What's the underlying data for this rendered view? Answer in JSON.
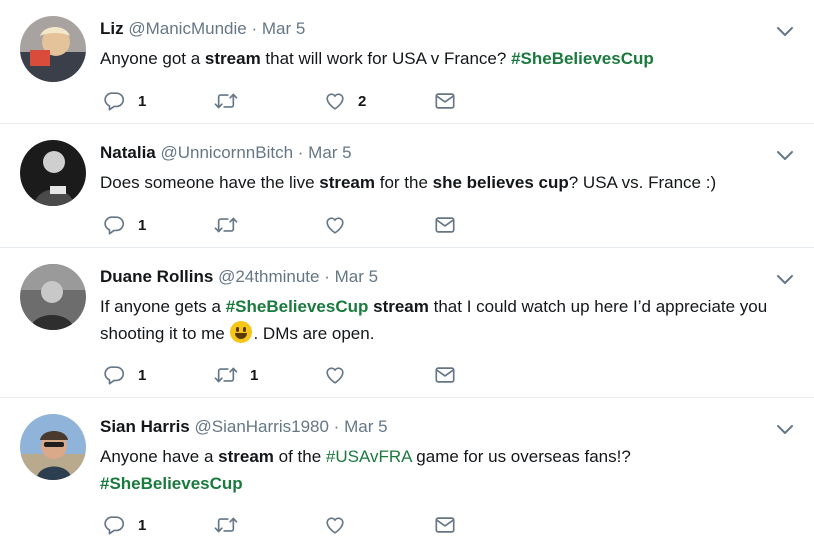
{
  "tweets": [
    {
      "name": "Liz",
      "handle": "@ManicMundie",
      "sep": "·",
      "date": "Mar 5",
      "text": {
        "t1": "Anyone got a ",
        "b1": "stream",
        "t2": " that will work for USA v France? ",
        "tag1": "#SheBelievesCup"
      },
      "actions": {
        "reply": "1",
        "retweet": "",
        "like": "2"
      }
    },
    {
      "name": "Natalia",
      "handle": "@UnnicornnBitch",
      "sep": "·",
      "date": "Mar 5",
      "text": {
        "t1": "Does someone have the live ",
        "b1": "stream",
        "t2": " for the ",
        "b2": "she believes cup",
        "t3": "? USA vs. France :)"
      },
      "actions": {
        "reply": "1",
        "retweet": "",
        "like": ""
      }
    },
    {
      "name": "Duane Rollins",
      "handle": "@24thminute",
      "sep": "·",
      "date": "Mar 5",
      "text": {
        "t1": "If anyone gets a ",
        "tag1": "#SheBelievesCup",
        "t2": " ",
        "b1": "stream",
        "t3": " that I could watch up here I’d appreciate you shooting it to me ",
        "t4": ". DMs are open."
      },
      "actions": {
        "reply": "1",
        "retweet": "1",
        "like": ""
      }
    },
    {
      "name": "Sian Harris",
      "handle": "@SianHarris1980",
      "sep": "·",
      "date": "Mar 5",
      "text": {
        "t1": "Anyone have a ",
        "b1": "stream",
        "t2": " of the ",
        "tag1": "#USAvFRA",
        "t3": " game for us overseas fans!?",
        "tag2": "#SheBelievesCup"
      },
      "actions": {
        "reply": "1",
        "retweet": "",
        "like": ""
      }
    }
  ],
  "colors": {
    "hashtag": "#1b7a3e",
    "muted": "#657786",
    "icon": "#657786",
    "divider": "#e6ecf0"
  },
  "icons": [
    "reply-icon",
    "retweet-icon",
    "like-icon",
    "message-icon",
    "chevron-down-icon",
    "smiley-emoji"
  ]
}
